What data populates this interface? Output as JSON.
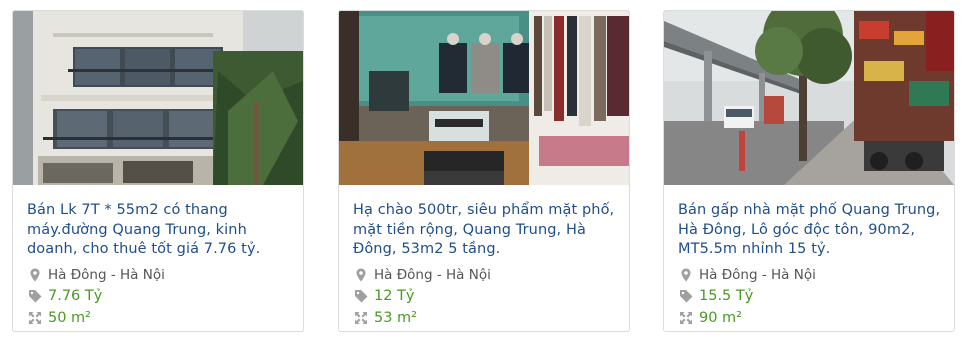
{
  "listings": [
    {
      "title": "Bán Lk 7T * 55m2 có thang máy.đường Quang Trung, kinh doanh, cho thuê tốt giá 7.76 tỷ.",
      "location": "Hà Đông - Hà Nội",
      "price": "7.76 Tỷ",
      "area": "50 m²",
      "photo_icon": "townhouse-facade-photo"
    },
    {
      "title": "Hạ chào 500tr, siêu phẩm mặt phố, mặt tiền rộng, Quang Trung, Hà Đông, 53m2 5 tầng.",
      "location": "Hà Đông - Hà Nội",
      "price": "12 Tỷ",
      "area": "53 m²",
      "photo_icon": "clothing-shop-interior-photo"
    },
    {
      "title": "Bán gấp nhà mặt phố Quang Trung, Hà Đông, Lô góc độc tôn, 90m2, MT5.5m nhỉnh 15 tỷ.",
      "location": "Hà Đông - Hà Nội",
      "price": "15.5 Tỷ",
      "area": "90 m²",
      "photo_icon": "street-view-photo"
    }
  ],
  "colors": {
    "title": "#1f4e8c",
    "price": "#4a9a22",
    "location": "#555555",
    "icon": "#a0a0a0"
  },
  "icons": {
    "location": "map-pin-icon",
    "price": "price-tag-icon",
    "area": "expand-arrows-icon"
  }
}
